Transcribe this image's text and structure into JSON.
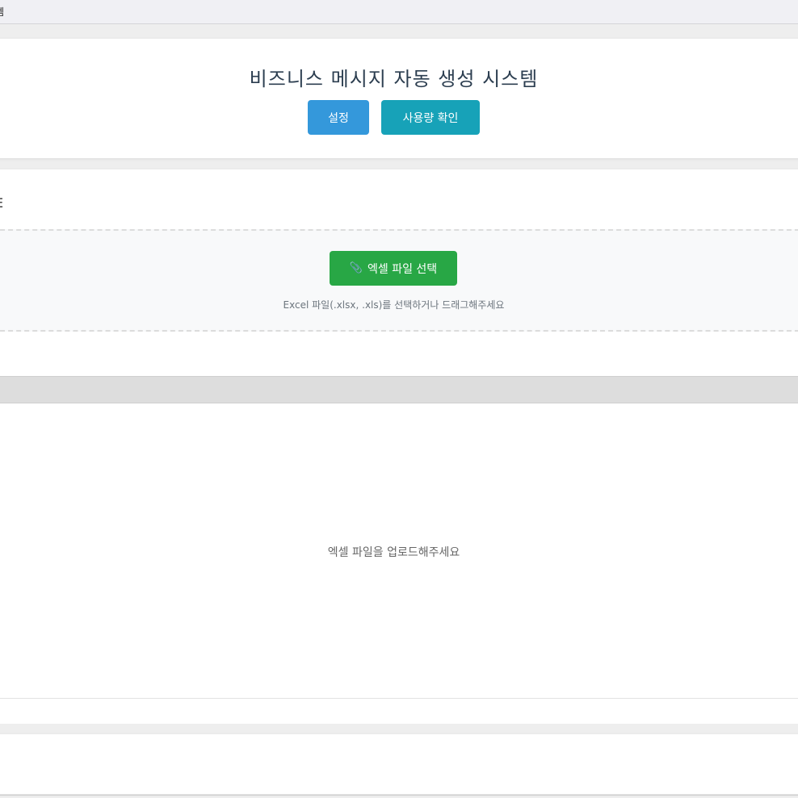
{
  "window": {
    "title_fragment": "템"
  },
  "header": {
    "title": "비즈니스 메시지 자동 생성 시스템",
    "settings_label": "설정",
    "usage_label": "사용량 확인"
  },
  "upload": {
    "heading_fragment": "E",
    "file_button_label": "엑셀 파일 선택",
    "file_button_icon": "paperclip-icon",
    "hint": "Excel 파일(.xlsx, .xls)를 선택하거나 드래그해주세요"
  },
  "preview": {
    "empty_message": "엑셀 파일을 업로드해주세요"
  },
  "colors": {
    "primary": "#3498db",
    "info": "#17a2b8",
    "success": "#28a745",
    "title": "#2c3e50"
  }
}
